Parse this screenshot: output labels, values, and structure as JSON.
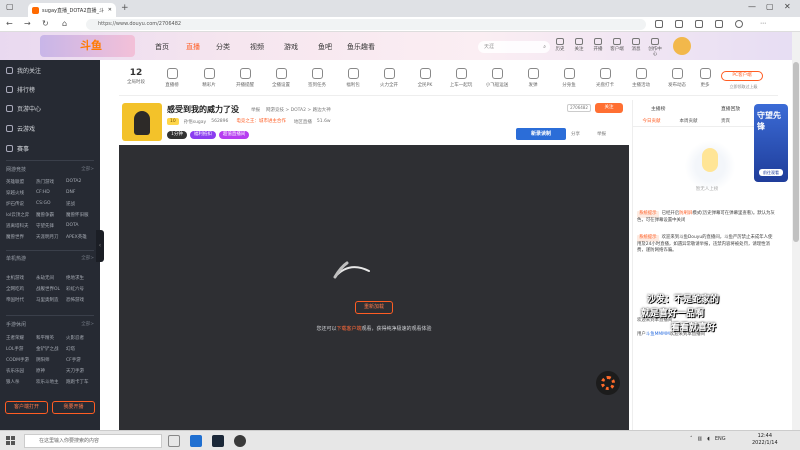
{
  "browser": {
    "tab_title": "sugay直播_DOTA2直播_斗",
    "url": "https://www.douyu.com/2706482"
  },
  "header": {
    "logo": "斗鱼",
    "nav": [
      "首页",
      "直播",
      "分类",
      "视频",
      "游戏",
      "鱼吧",
      "鱼乐趣看"
    ],
    "search_placeholder": "天涯",
    "icons": [
      "历史",
      "关注",
      "开播",
      "客户端",
      "消息",
      "创作中心"
    ]
  },
  "sidebar": {
    "main": [
      "我的关注",
      "排行榜",
      "页游中心",
      "云游戏",
      "赛事"
    ],
    "sections": [
      {
        "title": "网游竞技",
        "more": "全部>",
        "items": [
          "英雄联盟",
          "热门游戏",
          "DOTA2",
          "穿越火线",
          "CF:HD",
          "DNF",
          "炉石传说",
          "CS:GO",
          "逆战",
          "lol云顶之弈",
          "魔兽争霸",
          "魔兽怀旧服",
          "逃离塔科夫",
          "守望先锋",
          "DOTA",
          "魔兽世界",
          "天涯明月刀",
          "APEX英雄"
        ]
      },
      {
        "title": "单机热游",
        "more": "全部>",
        "items": [
          "主机游戏",
          "永劫无间",
          "绝地求生",
          "全网吃鸡",
          "战舰世界OL",
          "彩虹六号",
          "帝国时代",
          "马里奥制造",
          "恐怖游戏"
        ]
      },
      {
        "title": "手游休闲",
        "more": "全部>",
        "items": [
          "王者荣耀",
          "和平精英",
          "火影忍者",
          "LOL手游",
          "金铲铲之战",
          "幻塔",
          "CODM手游",
          "阴阳师",
          "CF手游",
          "农乐乐园",
          "原神",
          "天刀手游",
          "狼人杀",
          "欢乐斗地主",
          "跑跑卡丁车"
        ]
      }
    ],
    "buttons": [
      "客户端打开",
      "我要开播"
    ]
  },
  "categories": {
    "count": "12",
    "count_label": "全局时段",
    "items": [
      "直播榜",
      "精彩片",
      "开播提醒",
      "全播设置",
      "签到任务",
      "福利包",
      "火力全开",
      "全民PK",
      "上车一起玩",
      "小飞船运送",
      "发弹",
      "分身鱼",
      "光盘打卡",
      "主播活动",
      "发布动态",
      "更多"
    ],
    "client_btn": "PC客户端",
    "client_sub": "立即领取过上级"
  },
  "room": {
    "title": "感受到我的威力了没",
    "category_path": [
      "举报",
      "网游竞技 > DOTA2 > 路边大神"
    ],
    "level": "10",
    "streamer": "孙悟sugay",
    "fans": "562896",
    "badges": [
      "电竞之王：城市进主合作",
      "地区直播"
    ],
    "heat": "51.6w",
    "tags": [
      "1分钟",
      "福利抵扣",
      "超值直播间"
    ],
    "room_id": "2706482",
    "follow": "关注",
    "promo": "新录读制",
    "share": "分享",
    "report": "举报"
  },
  "player": {
    "reload": "重新加载",
    "tip_before": "您还可以",
    "tip_link": "下载客户端",
    "tip_after": "观看，获得纯净极速的观看体验"
  },
  "right_panel": {
    "top_tabs": [
      "主播榜",
      "直播回放"
    ],
    "tabs": [
      "今日贡献",
      "本周贡献",
      "贵宾",
      "钻粉"
    ],
    "empty_text": "暂无人上榜",
    "chat": [
      {
        "tag": "系统提示",
        "text": "已经开启",
        "hl": "防刷屏",
        "text2": "模式(历史弹幕可在弹幕里查看)。默认为灰色，可在弹幕设置中关闭"
      },
      {
        "tag": "系统提示",
        "text": "欢迎来到斗鱼Douyu的直播间，斗鱼严厉禁止未成年人使用及24小时直播，如遇异常敬请举报，违禁内容将被处罚，请理性消费，谨防网络诈骗。"
      },
      {
        "tag": "",
        "text": "欢迎来到本直播间"
      },
      {
        "tag": "",
        "text": "用户",
        "hl": "斗鱼MMMM",
        "text2": "欢迎来到本直播间"
      }
    ],
    "overlay": [
      "沙发：不是蛇家的",
      "就是喜好一品啊",
      "看看就喜好"
    ],
    "game_banner_title": "守望先锋",
    "game_banner_btn": "前往观看"
  },
  "taskbar": {
    "search": "在这里输入你要搜索的内容",
    "lang": "ENG",
    "time": "12:44",
    "date": "2022/1/14"
  },
  "colors": {
    "brand": "#ff5d23",
    "sidebar_bg": "#262a33",
    "player_bg": "#2e2f33"
  }
}
